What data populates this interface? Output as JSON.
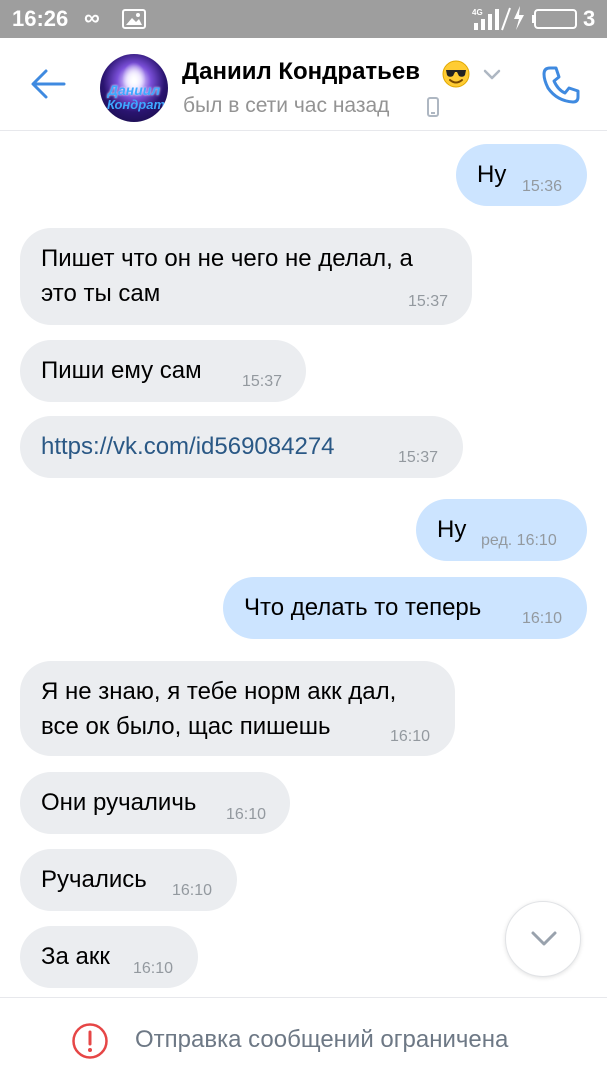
{
  "status_bar": {
    "time": "16:26",
    "infinity": "∞",
    "network": "4G",
    "battery": "3"
  },
  "header": {
    "contact_name": "Даниил Кондратьев",
    "emoji": "smiling-face-with-sunglasses",
    "status": "был в сети час назад",
    "avatar_text_line1": "Даниил",
    "avatar_text_line2": "Кондрат"
  },
  "messages": [
    {
      "dir": "out",
      "text": "Ну",
      "time": "15:36"
    },
    {
      "dir": "in",
      "text_lines": [
        "Пишет что он не чего не делал, а",
        "это ты сам"
      ],
      "time": "15:37"
    },
    {
      "dir": "in",
      "text": "Пиши  ему сам",
      "time": "15:37"
    },
    {
      "dir": "in",
      "text": "https://vk.com/id569084274",
      "time": "15:37",
      "is_link": true
    },
    {
      "dir": "out",
      "text": "Ну",
      "time": "ред. 16:10"
    },
    {
      "dir": "out",
      "text": "Что делать то теперь",
      "time": "16:10"
    },
    {
      "dir": "in",
      "text_lines": [
        "Я не знаю, я тебе норм акк дал,",
        "все ок было, щас пишешь"
      ],
      "time": "16:10"
    },
    {
      "dir": "in",
      "text": "Они ручаличь",
      "time": "16:10"
    },
    {
      "dir": "in",
      "text": "Ручались",
      "time": "16:10"
    },
    {
      "dir": "in",
      "text": "За акк",
      "time": "16:10"
    }
  ],
  "footer": {
    "text": "Отправка сообщений ограничена"
  },
  "colors": {
    "accent": "#3f8ae0",
    "incoming_bubble": "#ebedf0",
    "outgoing_bubble": "#cce4ff",
    "link": "#2a5885",
    "warning": "#e64646",
    "status_bar": "#9e9e9e"
  }
}
